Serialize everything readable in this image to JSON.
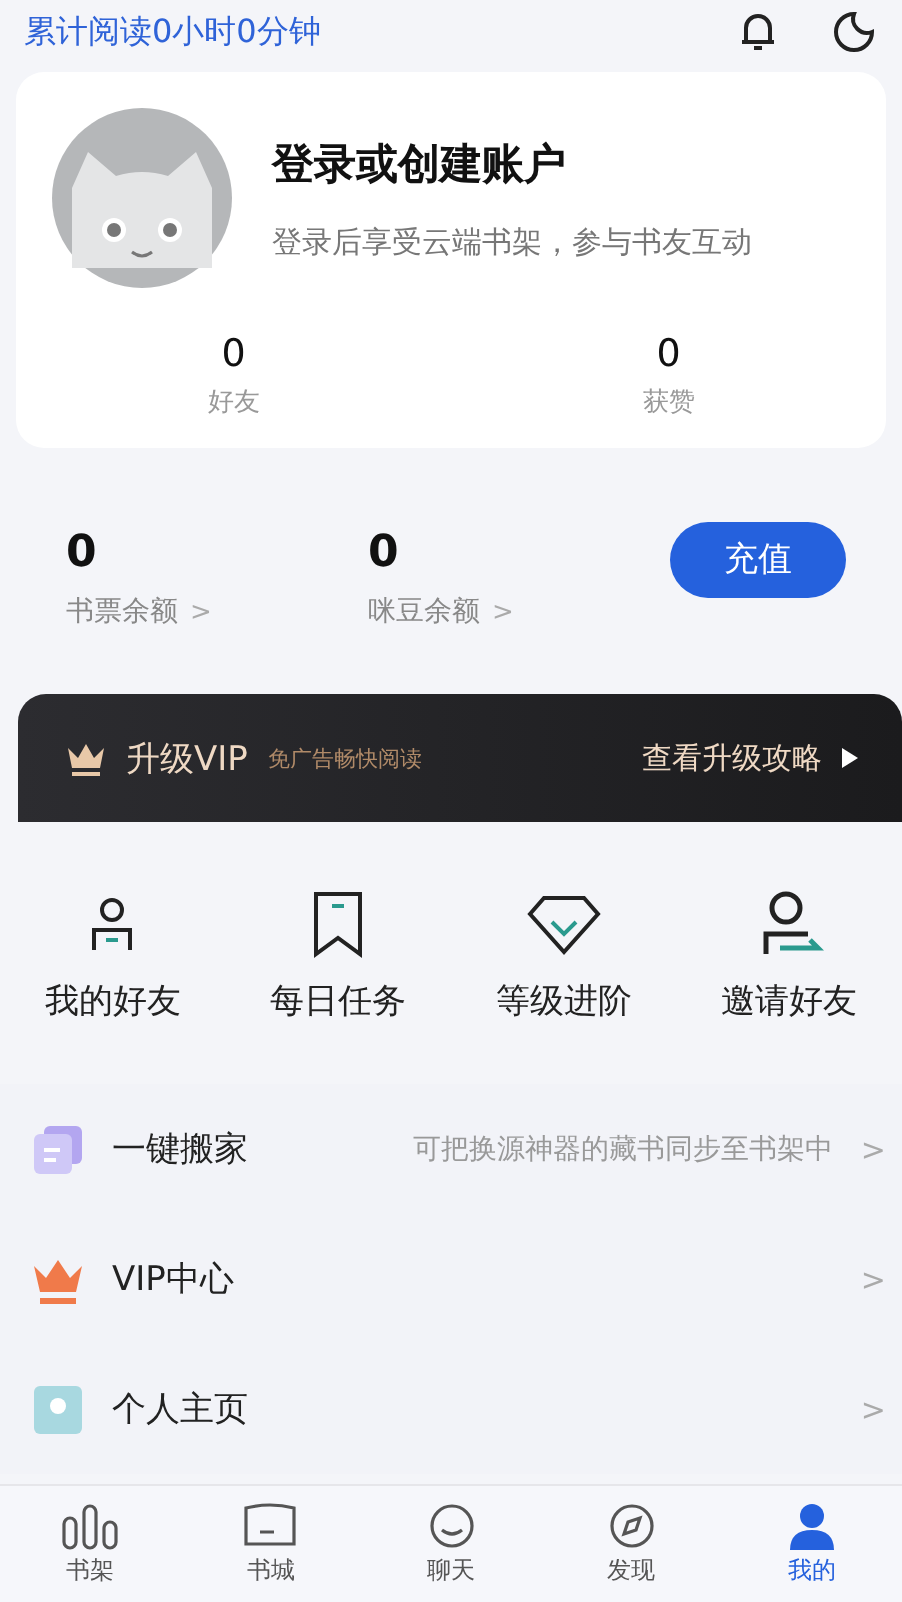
{
  "top_bar": {
    "reading_time": "累计阅读0小时0分钟"
  },
  "profile": {
    "title": "登录或创建账户",
    "subtitle": "登录后享受云端书架，参与书友互动",
    "stats": [
      {
        "value": "0",
        "label": "好友"
      },
      {
        "value": "0",
        "label": "获赞"
      }
    ]
  },
  "balances": [
    {
      "value": "0",
      "label": "书票余额",
      "arrow": ">"
    },
    {
      "value": "0",
      "label": "咪豆余额",
      "arrow": ">"
    }
  ],
  "recharge_button": "充值",
  "vip_banner": {
    "title": "升级VIP",
    "tagline": "免广告畅快阅读",
    "link": "查看升级攻略"
  },
  "shortcuts": [
    {
      "kind": "friend",
      "label": "我的好友"
    },
    {
      "kind": "bookmark",
      "label": "每日任务"
    },
    {
      "kind": "diamond",
      "label": "等级进阶"
    },
    {
      "kind": "invite",
      "label": "邀请好友"
    }
  ],
  "menu": [
    {
      "kind": "move",
      "label": "一键搬家",
      "hint": "可把换源神器的藏书同步至书架中",
      "arrow": ">"
    },
    {
      "kind": "vip",
      "label": "VIP中心",
      "arrow": ">"
    },
    {
      "kind": "home",
      "label": "个人主页",
      "arrow": ">"
    }
  ],
  "bottom_nav": [
    {
      "kind": "shelf",
      "label": "书架",
      "selected": false
    },
    {
      "kind": "store",
      "label": "书城",
      "selected": false
    },
    {
      "kind": "chat",
      "label": "聊天",
      "selected": false
    },
    {
      "kind": "discover",
      "label": "发现",
      "selected": false
    },
    {
      "kind": "me",
      "label": "我的",
      "selected": true
    }
  ]
}
